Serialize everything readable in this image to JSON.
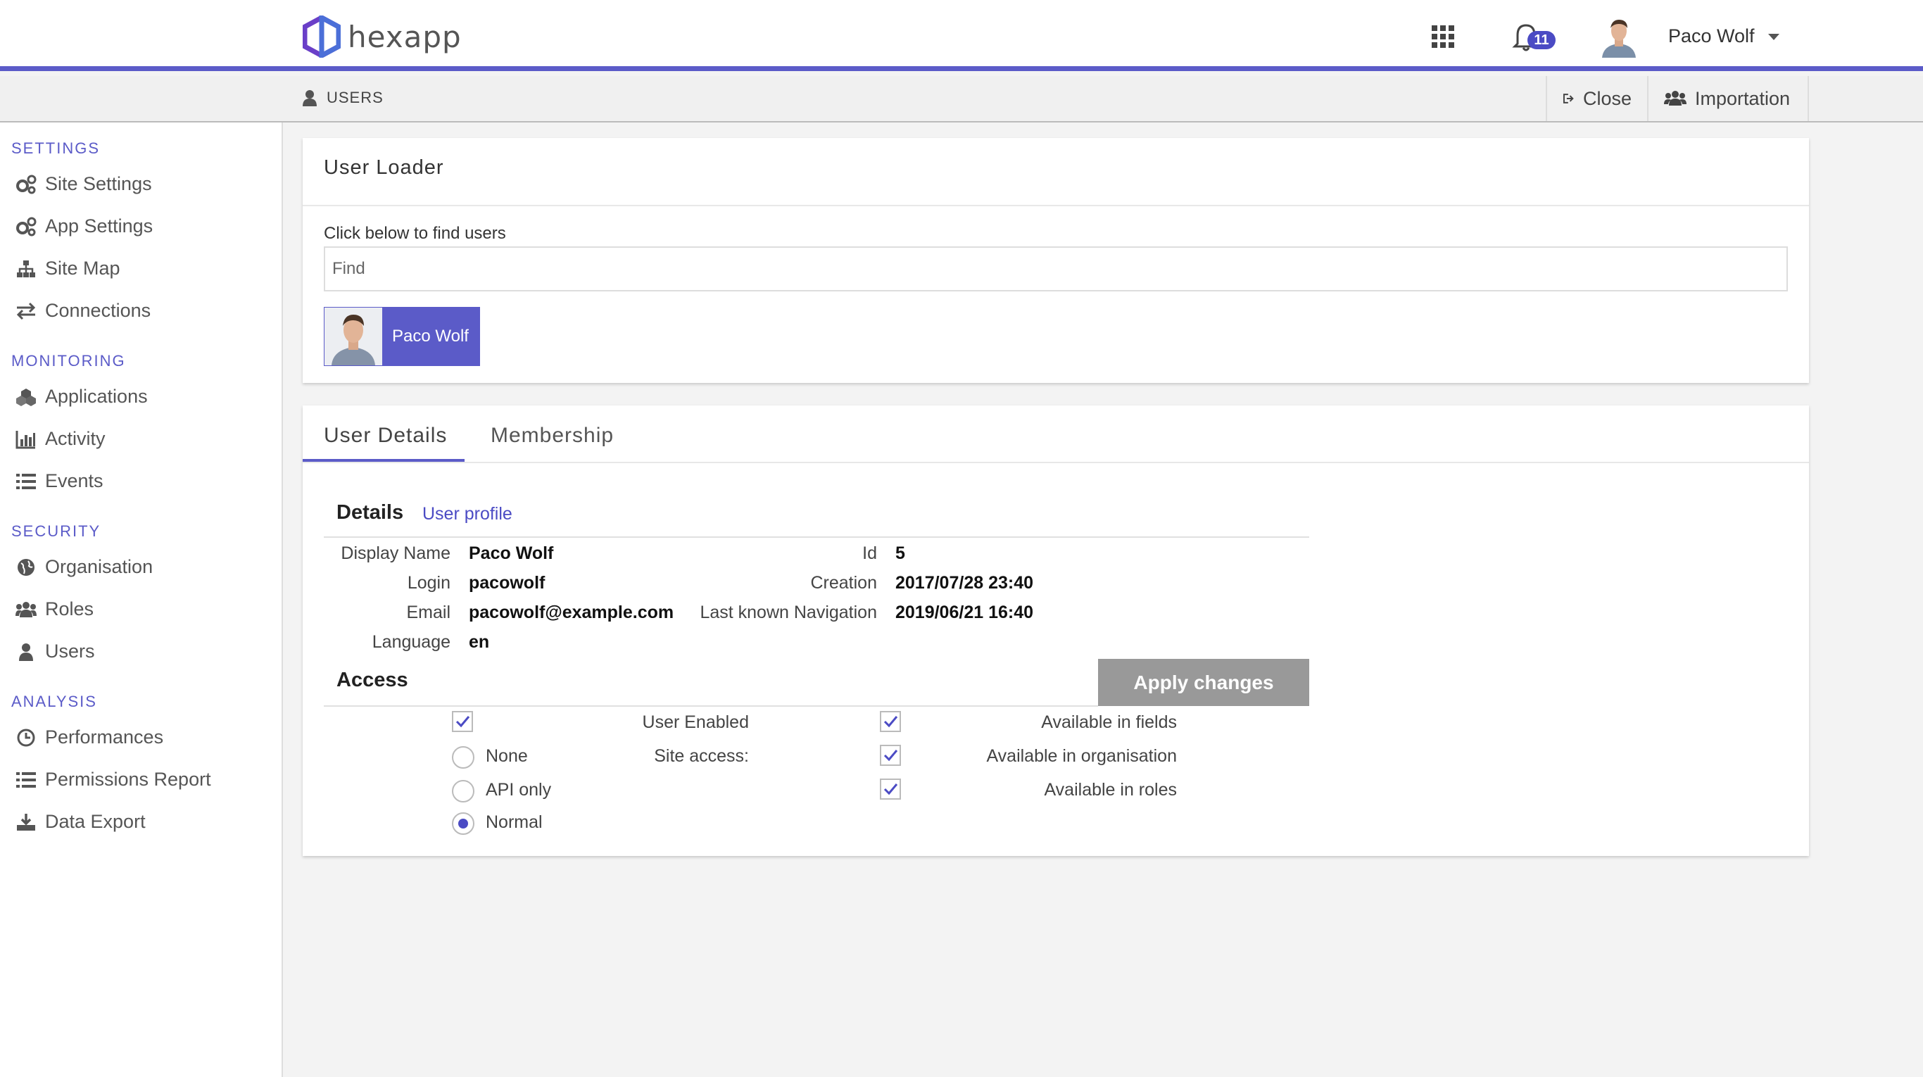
{
  "app": {
    "logo_text": "hexapp",
    "accent": "#5b5bc8"
  },
  "header": {
    "notifications_count": "11",
    "user_name": "Paco Wolf"
  },
  "subbar": {
    "title": "USERS",
    "close_label": "Close",
    "import_label": "Importation"
  },
  "sidebar": {
    "settings": {
      "heading": "SETTINGS",
      "items": [
        "Site Settings",
        "App Settings",
        "Site Map",
        "Connections"
      ]
    },
    "monitoring": {
      "heading": "MONITORING",
      "items": [
        "Applications",
        "Activity",
        "Events"
      ]
    },
    "security": {
      "heading": "SECURITY",
      "items": [
        "Organisation",
        "Roles",
        "Users"
      ]
    },
    "analysis": {
      "heading": "ANALYSIS",
      "items": [
        "Performances",
        "Permissions Report",
        "Data Export"
      ]
    }
  },
  "loader": {
    "title": "User Loader",
    "hint": "Click below to find users",
    "find_placeholder": "Find",
    "selected_user": "Paco Wolf"
  },
  "tabs": {
    "user_details": "User Details",
    "membership": "Membership"
  },
  "details": {
    "heading": "Details",
    "profile_link": "User profile",
    "display_name_label": "Display Name",
    "display_name": "Paco Wolf",
    "login_label": "Login",
    "login": "pacowolf",
    "email_label": "Email",
    "email": "pacowolf@example.com",
    "language_label": "Language",
    "language": "en",
    "id_label": "Id",
    "id": "5",
    "creation_label": "Creation",
    "creation": "2017/07/28 23:40",
    "last_nav_label": "Last known Navigation",
    "last_nav": "2019/06/21 16:40"
  },
  "access": {
    "heading": "Access",
    "apply_label": "Apply changes",
    "user_enabled_label": "User Enabled",
    "user_enabled": true,
    "site_access_label": "Site access:",
    "site_access_options": [
      "None",
      "API only",
      "Normal"
    ],
    "site_access_selected": "Normal",
    "available_fields_label": "Available in fields",
    "available_fields": true,
    "available_org_label": "Available in organisation",
    "available_org": true,
    "available_roles_label": "Available in roles",
    "available_roles": true
  }
}
